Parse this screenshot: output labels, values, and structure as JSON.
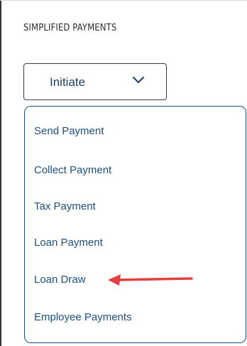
{
  "section": {
    "title": "SIMPLIFIED PAYMENTS"
  },
  "initiate_button": {
    "label": "Initiate",
    "icon": "chevron-down-icon"
  },
  "dropdown": {
    "items": [
      {
        "label": "Send Payment"
      },
      {
        "label": "Collect Payment"
      },
      {
        "label": "Tax Payment"
      },
      {
        "label": "Loan Payment"
      },
      {
        "label": "Loan Draw"
      },
      {
        "label": "Employee Payments"
      }
    ]
  },
  "annotation": {
    "icon": "red-arrow-icon",
    "color": "#e04040"
  },
  "colors": {
    "link": "#1c4e82",
    "dropdown_border": "#1c4f86",
    "button_text": "#1f3f66"
  }
}
